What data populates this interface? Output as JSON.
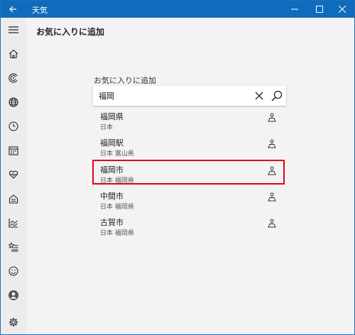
{
  "app": {
    "title": "天気"
  },
  "header": {
    "page_title": "お気に入りに追加"
  },
  "sidebar": {
    "items": [
      {
        "icon": "hamburger-icon"
      },
      {
        "icon": "home-icon"
      },
      {
        "icon": "radar-icon"
      },
      {
        "icon": "globe-icon"
      },
      {
        "icon": "clock-icon"
      },
      {
        "icon": "calendar-icon"
      },
      {
        "icon": "heart-icon"
      },
      {
        "icon": "building-icon"
      },
      {
        "icon": "chart-icon"
      },
      {
        "icon": "favorites-list-icon"
      },
      {
        "icon": "smiley-icon"
      },
      {
        "icon": "account-icon"
      },
      {
        "icon": "settings-icon"
      }
    ]
  },
  "search": {
    "label": "お気に入りに追加",
    "value": "福岡"
  },
  "results": [
    {
      "name": "福岡県",
      "region": "日本"
    },
    {
      "name": "福岡駅",
      "region": "日本 富山県"
    },
    {
      "name": "福岡市",
      "region": "日本 福岡県"
    },
    {
      "name": "中間市",
      "region": "日本 福岡県"
    },
    {
      "name": "古賀市",
      "region": "日本 福岡県"
    }
  ],
  "colors": {
    "titlebar": "#0f6cbd",
    "highlight": "#e0001b"
  }
}
